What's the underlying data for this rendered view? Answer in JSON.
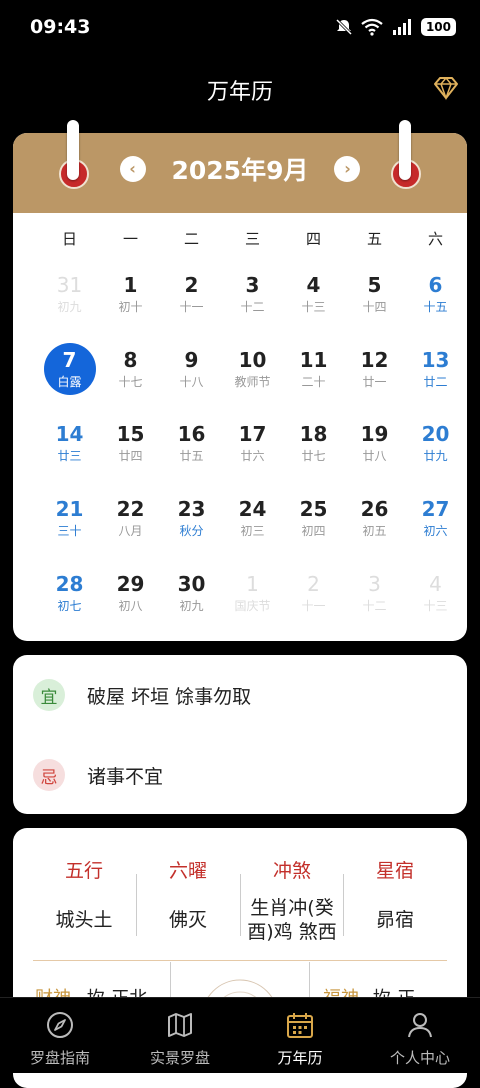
{
  "status_bar": {
    "time": "09:43",
    "battery": "100"
  },
  "header": {
    "title": "万年历"
  },
  "calendar": {
    "month_label": "2025年9月",
    "prev_label": "‹",
    "next_label": "›",
    "weekdays": [
      "日",
      "一",
      "二",
      "三",
      "四",
      "五",
      "六"
    ],
    "days": [
      {
        "d": "31",
        "sub": "初九"
      },
      {
        "d": "1",
        "sub": "初十"
      },
      {
        "d": "2",
        "sub": "十一"
      },
      {
        "d": "3",
        "sub": "十二"
      },
      {
        "d": "4",
        "sub": "十三"
      },
      {
        "d": "5",
        "sub": "十四"
      },
      {
        "d": "6",
        "sub": "十五"
      },
      {
        "d": "7",
        "sub": "白露"
      },
      {
        "d": "8",
        "sub": "十七"
      },
      {
        "d": "9",
        "sub": "十八"
      },
      {
        "d": "10",
        "sub": "教师节"
      },
      {
        "d": "11",
        "sub": "二十"
      },
      {
        "d": "12",
        "sub": "廿一"
      },
      {
        "d": "13",
        "sub": "廿二"
      },
      {
        "d": "14",
        "sub": "廿三"
      },
      {
        "d": "15",
        "sub": "廿四"
      },
      {
        "d": "16",
        "sub": "廿五"
      },
      {
        "d": "17",
        "sub": "廿六"
      },
      {
        "d": "18",
        "sub": "廿七"
      },
      {
        "d": "19",
        "sub": "廿八"
      },
      {
        "d": "20",
        "sub": "廿九"
      },
      {
        "d": "21",
        "sub": "三十"
      },
      {
        "d": "22",
        "sub": "八月"
      },
      {
        "d": "23",
        "sub": "秋分"
      },
      {
        "d": "24",
        "sub": "初三"
      },
      {
        "d": "25",
        "sub": "初四"
      },
      {
        "d": "26",
        "sub": "初五"
      },
      {
        "d": "27",
        "sub": "初六"
      },
      {
        "d": "28",
        "sub": "初七"
      },
      {
        "d": "29",
        "sub": "初八"
      },
      {
        "d": "30",
        "sub": "初九"
      },
      {
        "d": "1",
        "sub": "国庆节"
      },
      {
        "d": "2",
        "sub": "十一"
      },
      {
        "d": "3",
        "sub": "十二"
      },
      {
        "d": "4",
        "sub": "十三"
      }
    ]
  },
  "yiji": {
    "yi_badge": "宜",
    "yi_text": "破屋 坏垣 馀事勿取",
    "ji_badge": "忌",
    "ji_text": "诸事不宜"
  },
  "info": {
    "headers": [
      "五行",
      "六曜",
      "冲煞",
      "星宿"
    ],
    "values": [
      "城头土",
      "佛灭",
      "生肖冲(癸酉)鸡 煞西",
      "昴宿"
    ],
    "caishen_label": "财神",
    "caishen_value": "坎-正北",
    "fushen_label": "福神",
    "fushen_value": "坎-正"
  },
  "tabs": [
    {
      "label": "罗盘指南"
    },
    {
      "label": "实景罗盘"
    },
    {
      "label": "万年历"
    },
    {
      "label": "个人中心"
    }
  ],
  "colors": {
    "accent_gold": "#BB9766",
    "selected_blue": "#1466DA",
    "weekend_blue": "#2D7DD2",
    "info_red": "#c3302b"
  }
}
